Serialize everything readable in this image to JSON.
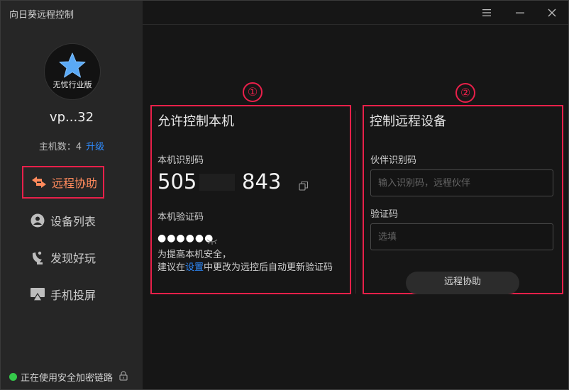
{
  "window": {
    "title": "向日葵远程控制"
  },
  "sidebar": {
    "edition": "无忧行业版",
    "username": "vp...32",
    "host_count_label": "主机数：4",
    "upgrade_label": "升级",
    "items": [
      {
        "label": "远程协助",
        "icon": "remote-assist-icon",
        "active": true
      },
      {
        "label": "设备列表",
        "icon": "device-list-icon"
      },
      {
        "label": "发现好玩",
        "icon": "discover-icon"
      },
      {
        "label": "手机投屏",
        "icon": "screen-cast-icon"
      }
    ],
    "status_text": "正在使用安全加密链路"
  },
  "markers": {
    "one": "①",
    "two": "②"
  },
  "allow_panel": {
    "title": "允许控制本机",
    "id_label": "本机识别码",
    "id_part1": "505",
    "id_part2": "843",
    "code_label": "本机验证码",
    "code_mask": "●●●●●●",
    "note_line1": "为提高本机安全，",
    "note_line2_pre": "建议在",
    "note_link": "设置",
    "note_line2_post": "中更改为远控后自动更新验证码"
  },
  "control_panel": {
    "title": "控制远程设备",
    "partner_label": "伙伴识别码",
    "partner_placeholder": "输入识别码，远程伙伴",
    "code_label": "验证码",
    "code_placeholder": "选填",
    "button_label": "远程协助"
  },
  "colors": {
    "accent": "#e8204a",
    "link": "#2f8cff",
    "status_ok": "#35c94a",
    "active_text": "#ff8a5c"
  }
}
